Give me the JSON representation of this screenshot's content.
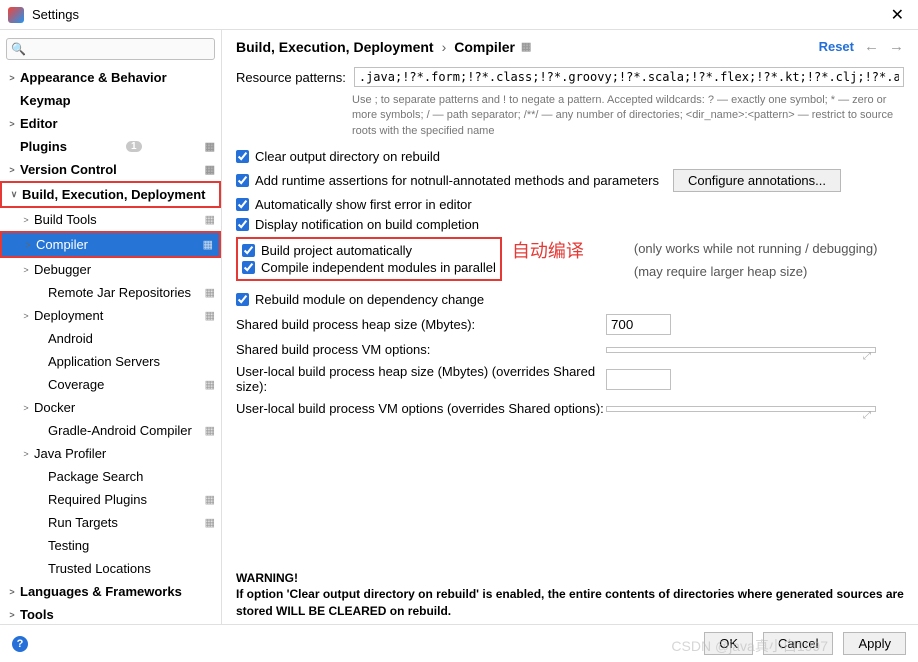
{
  "window": {
    "title": "Settings",
    "close": "✕"
  },
  "search": {
    "placeholder": ""
  },
  "sidebar": [
    {
      "label": "Appearance & Behavior",
      "bold": true,
      "chev": ">",
      "indent": 0
    },
    {
      "label": "Keymap",
      "bold": true,
      "indent": 0
    },
    {
      "label": "Editor",
      "bold": true,
      "chev": ">",
      "indent": 0
    },
    {
      "label": "Plugins",
      "bold": true,
      "indent": 0,
      "badge": "1",
      "gear": true
    },
    {
      "label": "Version Control",
      "bold": true,
      "chev": ">",
      "indent": 0,
      "gear": true
    },
    {
      "label": "Build, Execution, Deployment",
      "bold": true,
      "chev": "∨",
      "indent": 0,
      "redbox": true
    },
    {
      "label": "Build Tools",
      "chev": ">",
      "indent": 1,
      "gear": true
    },
    {
      "label": "Compiler",
      "chev": ">",
      "indent": 1,
      "selected": true,
      "redbox": true,
      "gear": true
    },
    {
      "label": "Debugger",
      "chev": ">",
      "indent": 1
    },
    {
      "label": "Remote Jar Repositories",
      "indent": 2,
      "gear": true
    },
    {
      "label": "Deployment",
      "chev": ">",
      "indent": 1,
      "gear": true
    },
    {
      "label": "Android",
      "indent": 2
    },
    {
      "label": "Application Servers",
      "indent": 2
    },
    {
      "label": "Coverage",
      "indent": 2,
      "gear": true
    },
    {
      "label": "Docker",
      "chev": ">",
      "indent": 1
    },
    {
      "label": "Gradle-Android Compiler",
      "indent": 2,
      "gear": true
    },
    {
      "label": "Java Profiler",
      "chev": ">",
      "indent": 1
    },
    {
      "label": "Package Search",
      "indent": 2
    },
    {
      "label": "Required Plugins",
      "indent": 2,
      "gear": true
    },
    {
      "label": "Run Targets",
      "indent": 2,
      "gear": true
    },
    {
      "label": "Testing",
      "indent": 2
    },
    {
      "label": "Trusted Locations",
      "indent": 2
    },
    {
      "label": "Languages & Frameworks",
      "bold": true,
      "chev": ">",
      "indent": 0
    },
    {
      "label": "Tools",
      "bold": true,
      "chev": ">",
      "indent": 0
    }
  ],
  "breadcrumb": {
    "a": "Build, Execution, Deployment",
    "sep": "›",
    "b": "Compiler",
    "reset": "Reset"
  },
  "resource": {
    "label": "Resource patterns:",
    "value": ".java;!?*.form;!?*.class;!?*.groovy;!?*.scala;!?*.flex;!?*.kt;!?*.clj;!?*.aj",
    "help": "Use ; to separate patterns and ! to negate a pattern. Accepted wildcards: ? — exactly one symbol; * — zero or more symbols; / — path separator; /**/ — any number of directories; <dir_name>:<pattern> — restrict to source roots with the specified name"
  },
  "checks": {
    "clear": "Clear output directory on rebuild",
    "assertions": "Add runtime assertions for notnull-annotated methods and parameters",
    "configure": "Configure annotations...",
    "firsterror": "Automatically show first error in editor",
    "notify": "Display notification on build completion",
    "buildauto": "Build project automatically",
    "buildauto_note": "(only works while not running / debugging)",
    "parallel": "Compile independent modules in parallel",
    "parallel_note": "(may require larger heap size)",
    "rebuild": "Rebuild module on dependency change"
  },
  "annotation": "自动编译",
  "options": {
    "heap": {
      "label": "Shared build process heap size (Mbytes):",
      "value": "700"
    },
    "vm": {
      "label": "Shared build process VM options:"
    },
    "userheap": {
      "label": "User-local build process heap size (Mbytes) (overrides Shared size):"
    },
    "uservm": {
      "label": "User-local build process VM options (overrides Shared options):"
    }
  },
  "warning": {
    "title": "WARNING!",
    "text": "If option 'Clear output directory on rebuild' is enabled, the entire contents of directories where generated sources are stored WILL BE CLEARED on rebuild."
  },
  "footer": {
    "ok": "OK",
    "cancel": "Cancel",
    "apply": "Apply"
  },
  "watermark": "CSDN @java真小白1997"
}
